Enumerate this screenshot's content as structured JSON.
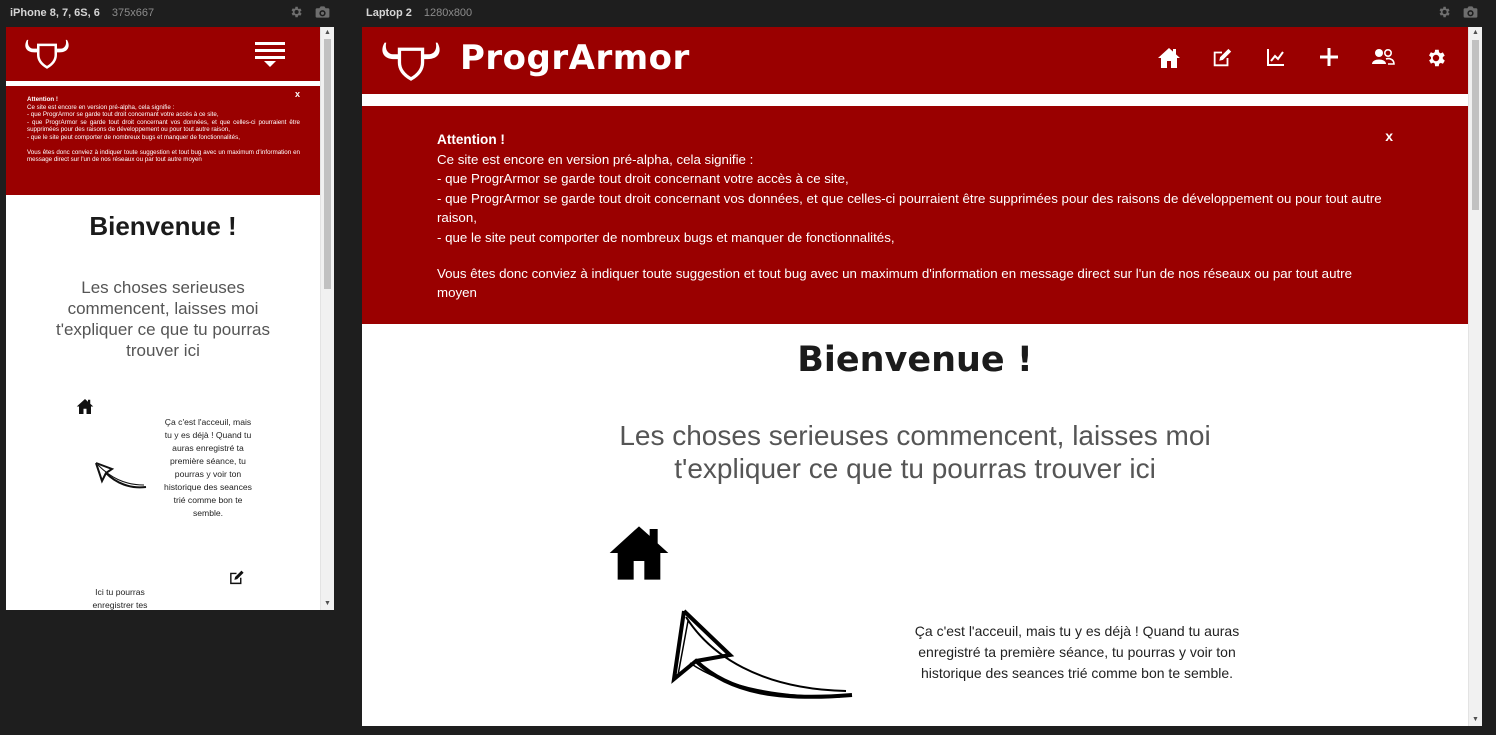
{
  "devices": {
    "phone": {
      "name": "iPhone 8, 7, 6S, 6",
      "size": "375x667"
    },
    "laptop": {
      "name": "Laptop 2",
      "size": "1280x800"
    },
    "settings_icon": "gear-icon",
    "screenshot_icon": "camera-icon"
  },
  "site": {
    "brand": "ProgrArmor",
    "brand_color": "#9a0000",
    "nav_icons": [
      "home-icon",
      "edit-icon",
      "chart-line-icon",
      "plus-icon",
      "users-icon",
      "gear-icon"
    ],
    "alert": {
      "title": "Attention !",
      "close": "x",
      "intro": "Ce site est encore en version pré-alpha, cela signifie :",
      "item1": "- que ProgrArmor se garde tout droit concernant votre accès à ce site,",
      "item2": "- que ProgrArmor se garde tout droit concernant vos données, et que celles-ci pourraient être supprimées pour des raisons de développement ou pour tout autre raison,",
      "item3": "- que le site peut comporter de nombreux bugs et manquer de fonctionnalités,",
      "footer": "Vous êtes donc conviez à indiquer toute suggestion et tout bug avec un maximum d'information en message direct sur l'un de nos réseaux ou par tout autre moyen"
    },
    "welcome_title": "Bienvenue !",
    "welcome_subtitle": "Les choses serieuses commencent, laisses moi t'expliquer ce que tu pourras trouver ici",
    "home_description": "Ça c'est l'acceuil, mais tu y es déjà ! Quand tu auras enregistré ta première séance, tu pourras y voir ton historique des seances trié comme bon te semble.",
    "edit_description_partial": "Ici tu pourras enregistrer tes"
  }
}
